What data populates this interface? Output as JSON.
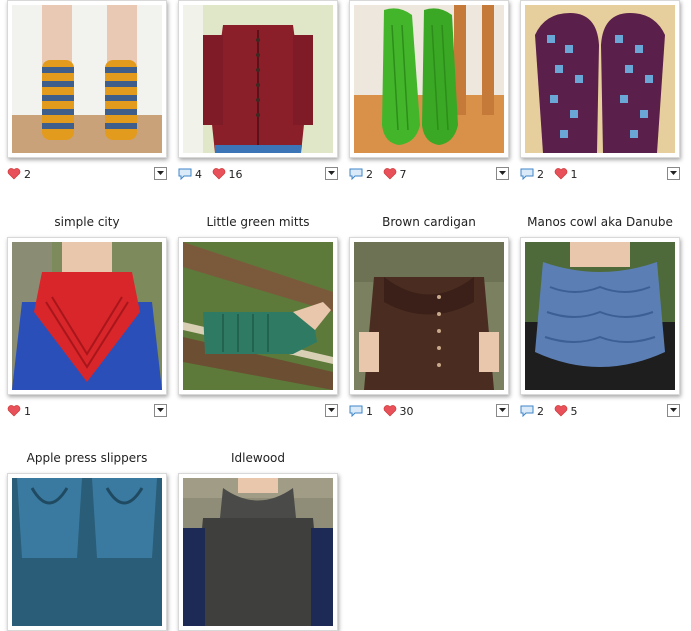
{
  "projects": [
    {
      "title": "",
      "comments": "",
      "hearts": "2"
    },
    {
      "title": "",
      "comments": "4",
      "hearts": "16"
    },
    {
      "title": "",
      "comments": "2",
      "hearts": "7"
    },
    {
      "title": "",
      "comments": "2",
      "hearts": "1"
    },
    {
      "title": "simple city",
      "comments": "",
      "hearts": "1"
    },
    {
      "title": "Little green mitts",
      "comments": "",
      "hearts": ""
    },
    {
      "title": "Brown cardigan",
      "comments": "1",
      "hearts": "30"
    },
    {
      "title": "Manos cowl aka Danube",
      "comments": "2",
      "hearts": "5"
    },
    {
      "title": "Apple press slippers",
      "comments": "",
      "hearts": ""
    },
    {
      "title": "Idlewood",
      "comments": "",
      "hearts": ""
    }
  ],
  "icons": {
    "comment": "speech-bubble-icon",
    "heart": "heart-icon",
    "menu": "dropdown-arrow-icon"
  },
  "colors": {
    "heart": "#e8505a",
    "comment_bubble": "#3f86c8"
  }
}
